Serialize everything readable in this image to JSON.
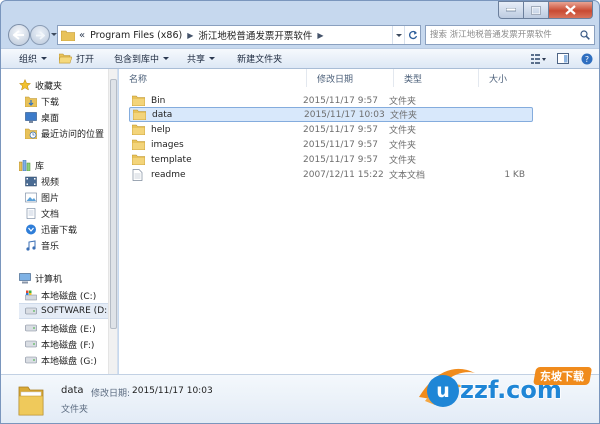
{
  "address": {
    "path": [
      "Program Files (x86)",
      "浙江地税普通发票开票软件"
    ]
  },
  "search": {
    "placeholder": "搜索 浙江地税普通发票开票软件"
  },
  "toolbar": {
    "organize": "组织",
    "open": "打开",
    "include_in_library": "包含到库中",
    "share": "共享",
    "new_folder": "新建文件夹"
  },
  "navpane": {
    "favorites": {
      "label": "收藏夹",
      "items": [
        "下载",
        "桌面",
        "最近访问的位置"
      ]
    },
    "libraries": {
      "label": "库",
      "items": [
        "视频",
        "图片",
        "文档",
        "迅雷下载",
        "音乐"
      ]
    },
    "computer": {
      "label": "计算机",
      "drives": [
        "本地磁盘 (C:)",
        "SOFTWARE (D:)",
        "本地磁盘 (E:)",
        "本地磁盘 (F:)",
        "本地磁盘 (G:)"
      ],
      "selected_drive_index": 1
    }
  },
  "filelist": {
    "columns": [
      "名称",
      "修改日期",
      "类型",
      "大小"
    ],
    "rows": [
      {
        "name": "Bin",
        "date": "2015/11/17 9:57",
        "type": "文件夹",
        "size": "",
        "kind": "folder"
      },
      {
        "name": "data",
        "date": "2015/11/17 10:03",
        "type": "文件夹",
        "size": "",
        "kind": "folder"
      },
      {
        "name": "help",
        "date": "2015/11/17 9:57",
        "type": "文件夹",
        "size": "",
        "kind": "folder"
      },
      {
        "name": "images",
        "date": "2015/11/17 9:57",
        "type": "文件夹",
        "size": "",
        "kind": "folder"
      },
      {
        "name": "template",
        "date": "2015/11/17 9:57",
        "type": "文件夹",
        "size": "",
        "kind": "folder"
      },
      {
        "name": "readme",
        "date": "2007/12/11 15:22",
        "type": "文本文档",
        "size": "1 KB",
        "kind": "text"
      }
    ],
    "selected_index": 1
  },
  "details": {
    "name": "data",
    "modified_label": "修改日期:",
    "modified_value": "2015/11/17 10:03",
    "type": "文件夹"
  },
  "watermark": {
    "site": "uzzf.com",
    "tagline": "东坡下载"
  },
  "colors": {
    "selection": "#d8e8fb",
    "selection_border": "#84acdd",
    "folder": "#e8c25a",
    "close_button": "#c94a32",
    "logo_blue": "#1f86d6",
    "logo_orange": "#f08b1c"
  }
}
